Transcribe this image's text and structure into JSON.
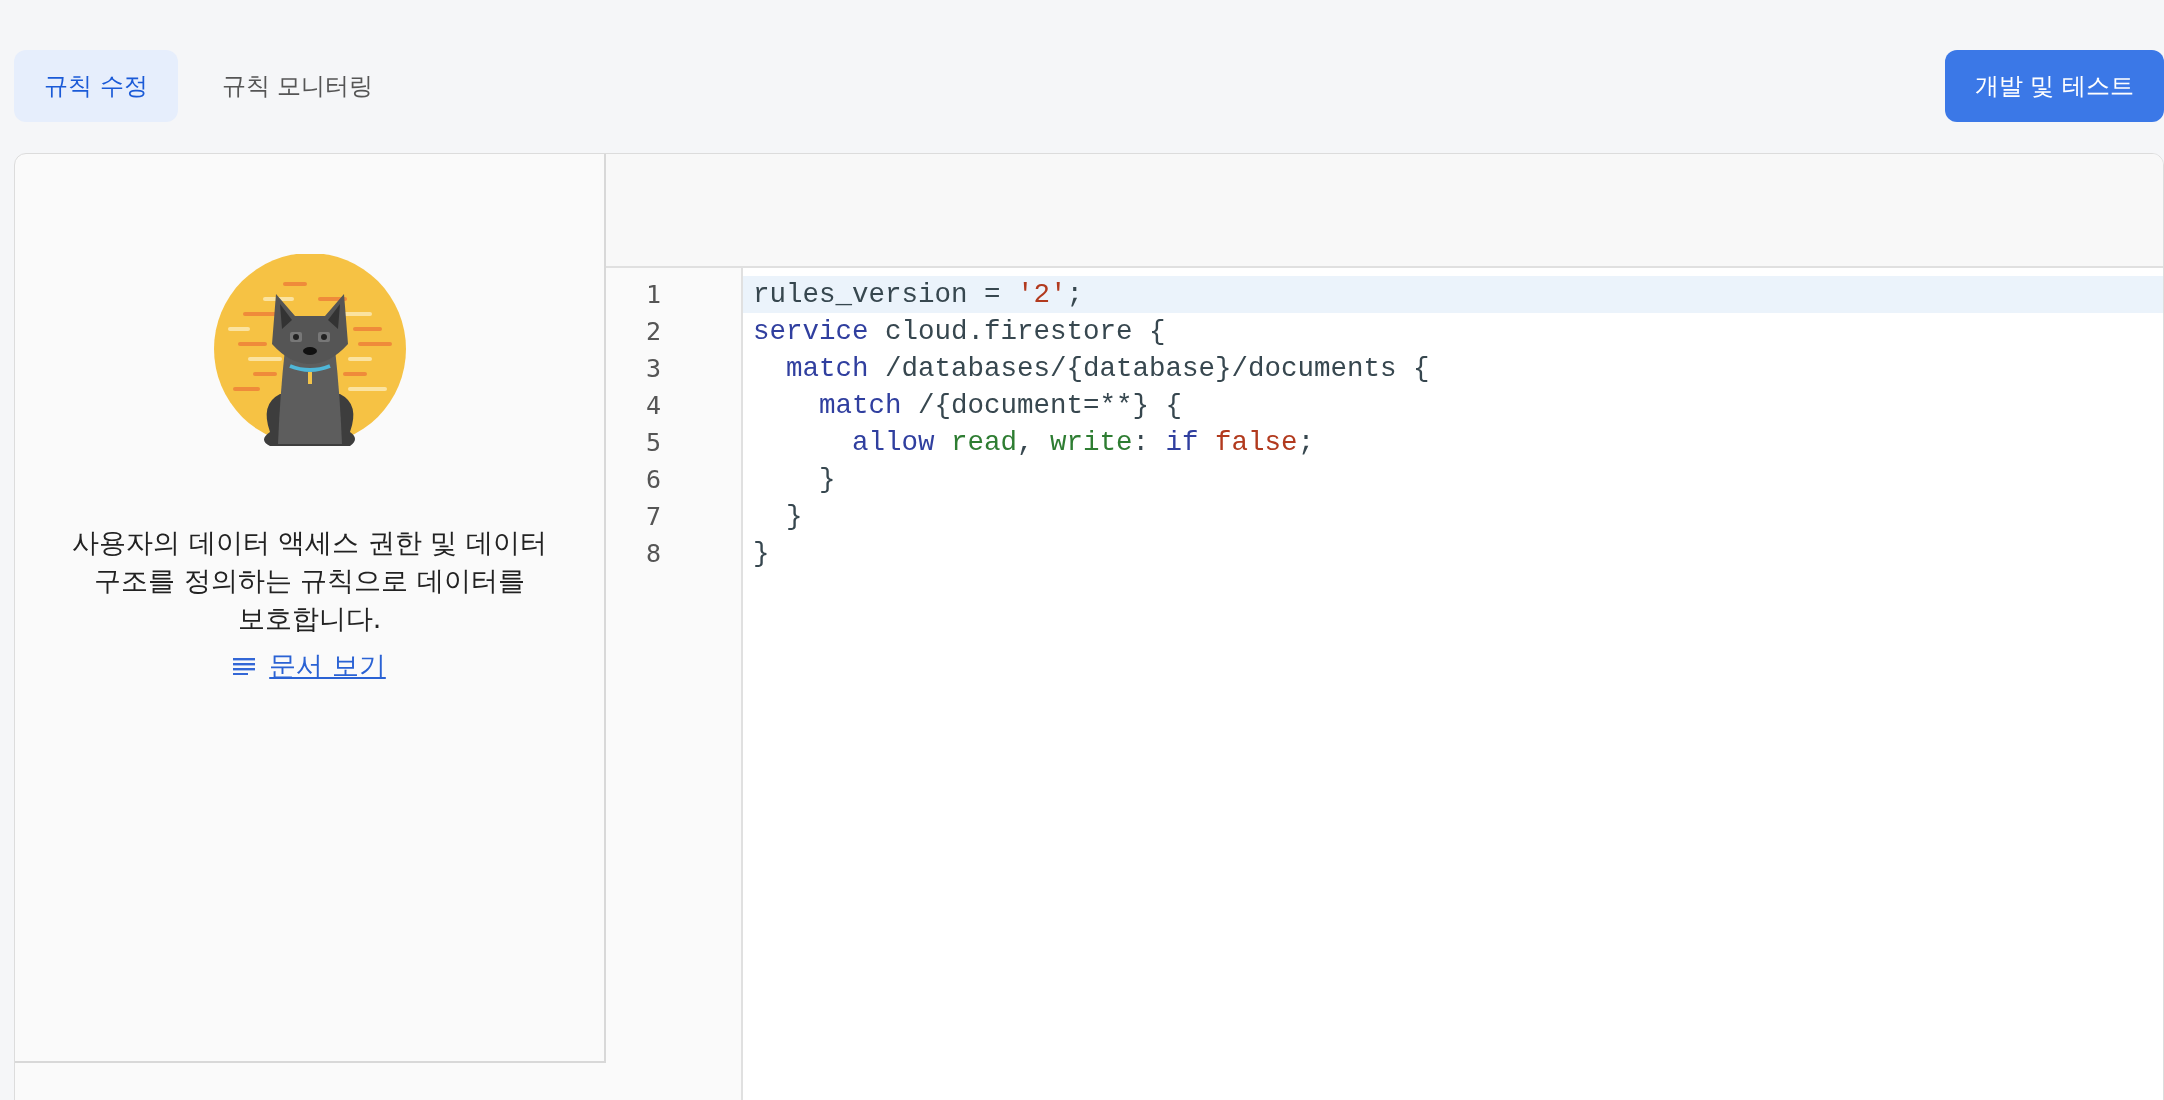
{
  "tabs": [
    {
      "label": "규칙 수정",
      "selected": true
    },
    {
      "label": "규칙 모니터링",
      "selected": false
    }
  ],
  "primary_button": "개발 및 테스트",
  "info_panel": {
    "description": "사용자의 데이터 액세스 권한 및 데이터 구조를 정의하는 규칙으로 데이터를 보호합니다.",
    "docs_link": "문서 보기"
  },
  "editor": {
    "lines": [
      {
        "number": "1",
        "highlighted": true,
        "tokens": [
          {
            "text": "rules_version = ",
            "kind": "plain"
          },
          {
            "text": "'2'",
            "kind": "string"
          },
          {
            "text": ";",
            "kind": "plain"
          }
        ]
      },
      {
        "number": "2",
        "highlighted": false,
        "tokens": [
          {
            "text": "service",
            "kind": "keyword"
          },
          {
            "text": " cloud.firestore {",
            "kind": "plain"
          }
        ]
      },
      {
        "number": "3",
        "highlighted": false,
        "tokens": [
          {
            "text": "  match",
            "kind": "keyword"
          },
          {
            "text": " /databases/{database}/documents {",
            "kind": "plain"
          }
        ]
      },
      {
        "number": "4",
        "highlighted": false,
        "tokens": [
          {
            "text": "    match",
            "kind": "keyword"
          },
          {
            "text": " /{document=**} {",
            "kind": "plain"
          }
        ]
      },
      {
        "number": "5",
        "highlighted": false,
        "tokens": [
          {
            "text": "      allow",
            "kind": "keyword"
          },
          {
            "text": " read",
            "kind": "property"
          },
          {
            "text": ", ",
            "kind": "plain"
          },
          {
            "text": "write",
            "kind": "property"
          },
          {
            "text": ": ",
            "kind": "plain"
          },
          {
            "text": "if",
            "kind": "keyword"
          },
          {
            "text": " false",
            "kind": "string"
          },
          {
            "text": ";",
            "kind": "plain"
          }
        ]
      },
      {
        "number": "6",
        "highlighted": false,
        "tokens": [
          {
            "text": "    }",
            "kind": "plain"
          }
        ]
      },
      {
        "number": "7",
        "highlighted": false,
        "tokens": [
          {
            "text": "  }",
            "kind": "plain"
          }
        ]
      },
      {
        "number": "8",
        "highlighted": false,
        "tokens": [
          {
            "text": "}",
            "kind": "plain"
          }
        ]
      }
    ]
  }
}
